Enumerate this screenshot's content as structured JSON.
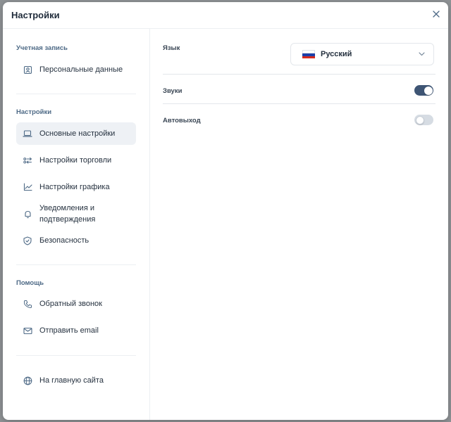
{
  "modal": {
    "title": "Настройки"
  },
  "sidebar": {
    "account": {
      "title": "Учетная запись",
      "items": [
        {
          "label": "Персональные данные",
          "icon": "user-card-icon"
        }
      ]
    },
    "settings": {
      "title": "Настройки",
      "items": [
        {
          "label": "Основные настройки",
          "icon": "laptop-icon",
          "active": true
        },
        {
          "label": "Настройки торговли",
          "icon": "trading-icon"
        },
        {
          "label": "Настройки графика",
          "icon": "chart-line-icon"
        },
        {
          "label": "Уведомления и подтверждения",
          "icon": "bell-icon"
        },
        {
          "label": "Безопасность",
          "icon": "shield-icon"
        }
      ]
    },
    "help": {
      "title": "Помощь",
      "items": [
        {
          "label": "Обратный звонок",
          "icon": "phone-icon"
        },
        {
          "label": "Отправить email",
          "icon": "mail-icon"
        }
      ]
    },
    "footer": {
      "items": [
        {
          "label": "На главную сайта",
          "icon": "globe-icon"
        }
      ]
    }
  },
  "content": {
    "language": {
      "label": "Язык",
      "value": "Русский",
      "flag": "russia-flag-icon"
    },
    "sounds": {
      "label": "Звуки",
      "enabled": true
    },
    "autologout": {
      "label": "Автовыход",
      "enabled": false
    }
  },
  "colors": {
    "accent": "#3e5574",
    "section_title": "#4e6a86",
    "active_bg": "#eef1f5",
    "toggle_off": "#d6dce3",
    "backdrop": "#8f9396"
  }
}
